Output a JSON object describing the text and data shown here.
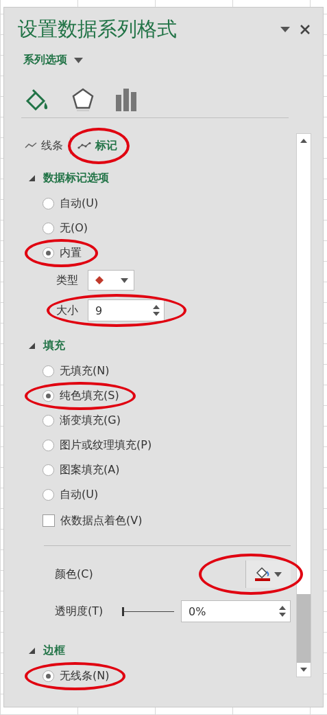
{
  "pane": {
    "title": "设置数据系列格式",
    "menu": "系列选项"
  },
  "category_icons": [
    {
      "kind": "fill",
      "selected": true
    },
    {
      "kind": "effects",
      "selected": false
    },
    {
      "kind": "series",
      "selected": false
    }
  ],
  "tabs": [
    {
      "label": "线条",
      "kind": "line",
      "selected": false,
      "highlighted": false
    },
    {
      "label": "标记",
      "kind": "marker",
      "selected": true,
      "highlighted": true
    }
  ],
  "sections": [
    {
      "title": "数据标记选项",
      "expanded": true,
      "items": [
        {
          "kind": "radio",
          "label": "自动(U)",
          "selected": false,
          "highlighted": false
        },
        {
          "kind": "radio",
          "label": "无(O)",
          "selected": false,
          "highlighted": false
        },
        {
          "kind": "radio",
          "label": "内置",
          "selected": true,
          "highlighted": true
        },
        {
          "kind": "select",
          "label": "类型",
          "highlighted": false
        },
        {
          "kind": "spinner",
          "label": "大小",
          "value": "9",
          "highlighted": true
        }
      ]
    },
    {
      "title": "填充",
      "expanded": true,
      "items": [
        {
          "kind": "radio",
          "label": "无填充(N)",
          "selected": false,
          "highlighted": false
        },
        {
          "kind": "radio",
          "label": "纯色填充(S)",
          "selected": true,
          "highlighted": true
        },
        {
          "kind": "radio",
          "label": "渐变填充(G)",
          "selected": false,
          "highlighted": false
        },
        {
          "kind": "radio",
          "label": "图片或纹理填充(P)",
          "selected": false,
          "highlighted": false
        },
        {
          "kind": "radio",
          "label": "图案填充(A)",
          "selected": false,
          "highlighted": false
        },
        {
          "kind": "radio",
          "label": "自动(U)",
          "selected": false,
          "highlighted": false
        },
        {
          "kind": "checkbox",
          "label": "依数据点着色(V)",
          "checked": false
        },
        {
          "kind": "divider"
        },
        {
          "kind": "color",
          "label": "颜色(C)",
          "color": "#c00000",
          "highlighted": true
        },
        {
          "kind": "slider",
          "label": "透明度(T)",
          "level": 0,
          "value": "0%"
        }
      ]
    },
    {
      "title": "边框",
      "expanded": true,
      "items": [
        {
          "kind": "radio",
          "label": "无线条(N)",
          "selected": true,
          "highlighted": true
        }
      ]
    }
  ]
}
